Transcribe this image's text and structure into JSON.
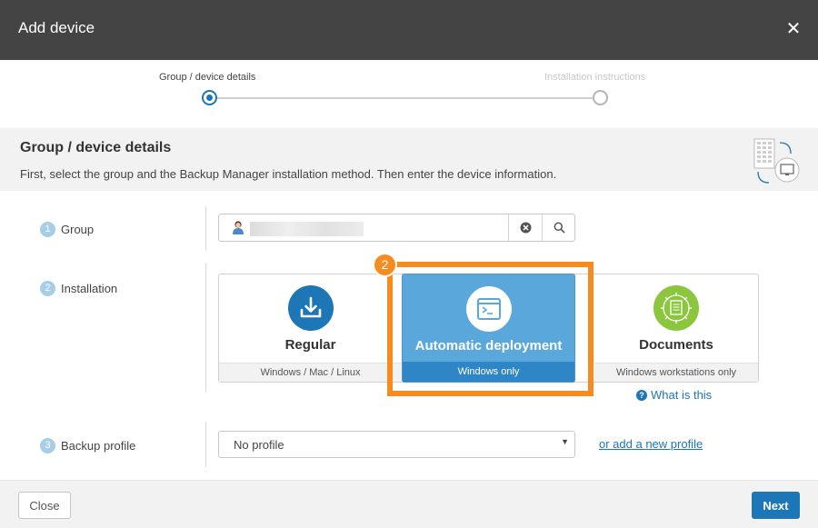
{
  "dialog": {
    "title": "Add device",
    "close_icon": "close-icon"
  },
  "stepper": {
    "steps": [
      {
        "label": "Group / device details",
        "state": "active"
      },
      {
        "label": "Installation instructions",
        "state": "inactive"
      }
    ]
  },
  "section": {
    "title": "Group / device details",
    "description": "First, select the group and the Backup Manager installation method. Then enter the device information."
  },
  "group": {
    "number": "1",
    "label": "Group",
    "user_icon": "user-icon",
    "clear_icon": "clear-icon",
    "search_icon": "search-icon"
  },
  "installation": {
    "number": "2",
    "label": "Installation",
    "options": [
      {
        "title": "Regular",
        "subtitle": "Windows / Mac / Linux",
        "icon": "download-icon",
        "selected": false
      },
      {
        "title": "Automatic deployment",
        "subtitle": "Windows only",
        "icon": "terminal-icon",
        "selected": true
      },
      {
        "title": "Documents",
        "subtitle": "Windows workstations only",
        "icon": "document-gear-icon",
        "selected": false
      }
    ],
    "help_link": "What is this",
    "highlight_badge": "2"
  },
  "backup_profile": {
    "number": "3",
    "label": "Backup profile",
    "selected": "No profile",
    "add_link": "or add a new profile"
  },
  "footer": {
    "close_label": "Close",
    "next_label": "Next"
  },
  "colors": {
    "titlebar": "#444444",
    "primary": "#1d76b6",
    "selected_card": "#5aa7dc",
    "highlight": "#f68c1f",
    "documents_icon": "#8cc63f"
  }
}
